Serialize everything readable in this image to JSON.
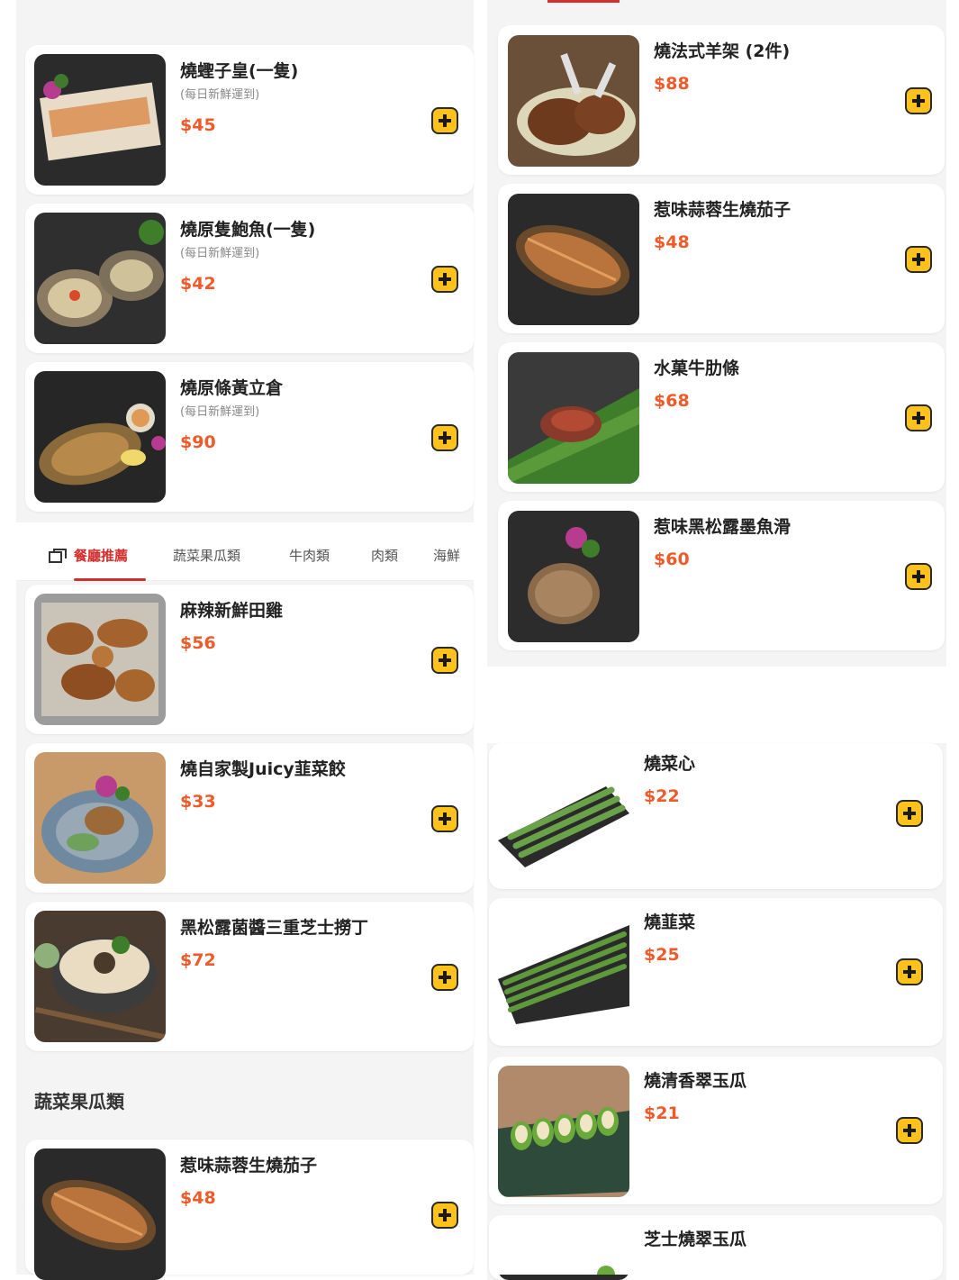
{
  "tabs": [
    {
      "label": "餐廳推薦",
      "active": true
    },
    {
      "label": "蔬菜果瓜類",
      "active": false
    },
    {
      "label": "牛肉類",
      "active": false
    },
    {
      "label": "肉類",
      "active": false
    },
    {
      "label": "海鮮",
      "active": false
    }
  ],
  "left_top_items": [
    {
      "name": "燒蟶子皇(一隻)",
      "note": "(每日新鮮運到)",
      "price": "$45"
    },
    {
      "name": "燒原隻鮑魚(一隻)",
      "note": "(每日新鮮運到)",
      "price": "$42"
    },
    {
      "name": "燒原條黃立倉",
      "note": "(每日新鮮運到)",
      "price": "$90"
    }
  ],
  "left_bottom_items": [
    {
      "name": "麻辣新鮮田雞",
      "price": "$56"
    },
    {
      "name": "燒自家製Juicy韮菜餃",
      "price": "$33"
    },
    {
      "name": "黑松露菌醬三重芝士撈丁",
      "price": "$72"
    }
  ],
  "section": {
    "title": "蔬菜果瓜類"
  },
  "left_section_items": [
    {
      "name": "惹味蒜蓉生燒茄子",
      "price": "$48"
    }
  ],
  "right_top_items": [
    {
      "name": "燒法式羊架 (2件)",
      "price": "$88"
    },
    {
      "name": "惹味蒜蓉生燒茄子",
      "price": "$48"
    },
    {
      "name": "水菓牛肋條",
      "price": "$68"
    },
    {
      "name": "惹味黑松露墨魚滑",
      "price": "$60"
    }
  ],
  "right_bottom_items": [
    {
      "name": "燒菜心",
      "price": "$22"
    },
    {
      "name": "燒韮菜",
      "price": "$25"
    },
    {
      "name": "燒清香翠玉瓜",
      "price": "$21"
    },
    {
      "name": "芝士燒翠玉瓜",
      "price": ""
    }
  ],
  "colors": {
    "accent": "#d32f2f",
    "price": "#ef5a28",
    "add_button": "#ffc21a"
  },
  "icons": {
    "add": "plus-icon",
    "tab": "menu-icon"
  }
}
